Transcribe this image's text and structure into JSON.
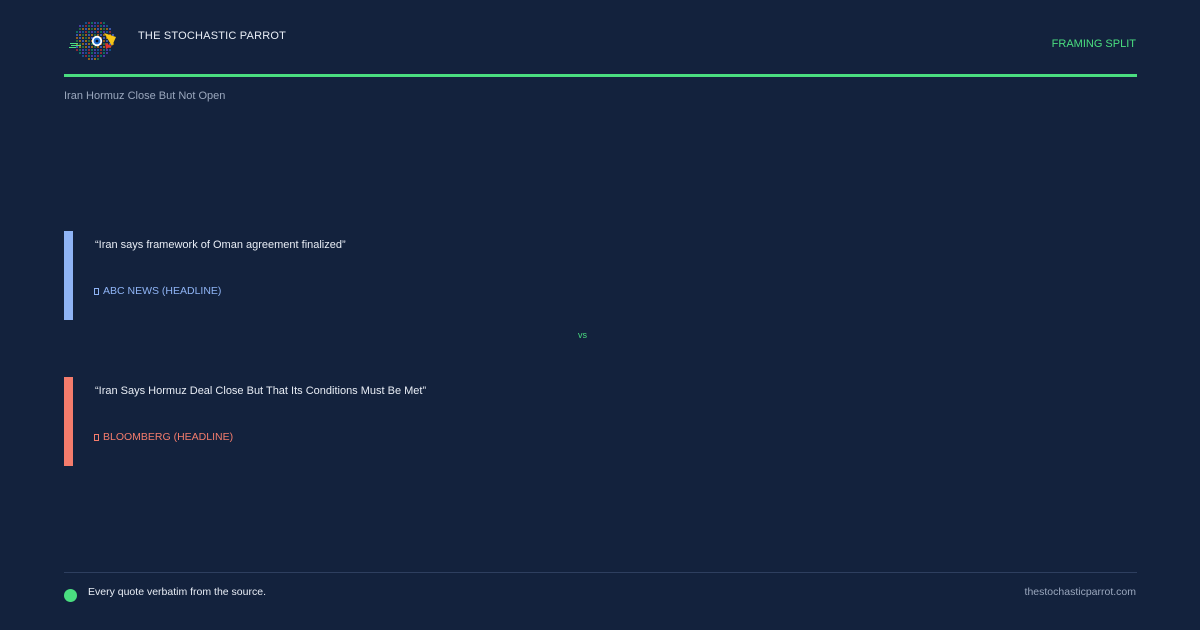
{
  "brand": {
    "name": "THE STOCHASTIC PARROT",
    "logo_icon": "parrot-logo-icon",
    "accent_color": "#4ade80"
  },
  "header": {
    "section_tag": "FRAMING SPLIT"
  },
  "story": {
    "title": "Iran Hormuz Close But Not Open"
  },
  "quotes": [
    {
      "text": "“Iran says framework of Oman agreement finalized”",
      "source": "ABC NEWS (HEADLINE)",
      "source_icon": "document-icon",
      "color": "#8fb4f5"
    },
    {
      "text": "“Iran Says Hormuz Deal Close But That Its Conditions Must Be Met”",
      "source": "BLOOMBERG (HEADLINE)",
      "source_icon": "document-icon",
      "color": "#f47c6c"
    }
  ],
  "separator": {
    "label": "vs"
  },
  "footer": {
    "note": "Every quote verbatim from the source.",
    "site": "thestochasticparrot.com"
  }
}
